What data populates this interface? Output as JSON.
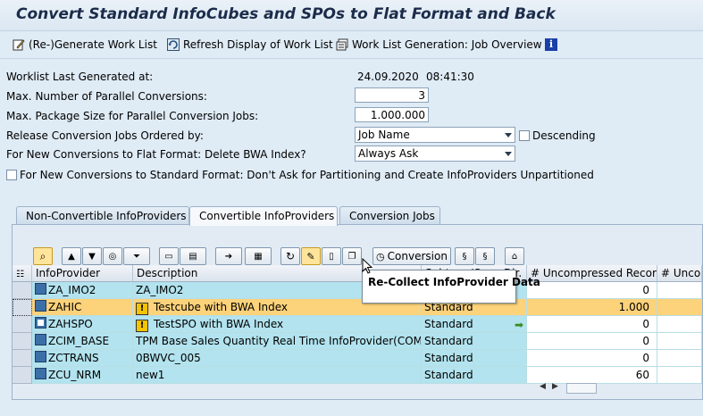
{
  "window": {
    "title": "Convert Standard InfoCubes and SPOs to Flat Format and Back"
  },
  "appbar": {
    "regenerate_label": "(Re-)Generate Work List",
    "refresh_label": "Refresh Display of Work List",
    "job_overview_label": "Work List Generation: Job Overview",
    "info_icon": "i"
  },
  "form": {
    "worklist_generated_label": "Worklist Last Generated at:",
    "worklist_date": "24.09.2020",
    "worklist_time": "08:41:30",
    "max_parallel_label": "Max. Number of Parallel Conversions:",
    "max_parallel_value": "3",
    "max_package_label": "Max. Package Size for Parallel Conversion Jobs:",
    "max_package_value": "1.000.000",
    "release_order_label": "Release Conversion Jobs Ordered by:",
    "release_order_value": "Job Name",
    "descending_label": "Descending",
    "delete_bwa_label": "For New Conversions to Flat Format: Delete BWA Index?",
    "delete_bwa_value": "Always Ask",
    "partition_label": "For New Conversions to Standard Format: Don't Ask for Partitioning and Create InfoProviders Unpartitioned"
  },
  "tabs": [
    {
      "label": "Non-Convertible InfoProviders"
    },
    {
      "label": "Convertible InfoProviders"
    },
    {
      "label": "Conversion Jobs"
    }
  ],
  "toolbar": {
    "conversion_label": "Conversion"
  },
  "tooltip": "Re-Collect InfoProvider Data",
  "grid": {
    "headers": [
      "InfoProvider",
      "Description",
      "Subtype/Copy Dir.",
      "# Uncompressed Records",
      "# Uncom"
    ],
    "rows": [
      {
        "provider": "ZA_IMO2",
        "description": "ZA_IMO2",
        "warn": false,
        "subtype": "",
        "records": "0",
        "icon": "cube"
      },
      {
        "provider": "ZAHIC",
        "description": "Testcube with BWA Index",
        "warn": true,
        "subtype": "Standard",
        "records": "1.000",
        "icon": "cube"
      },
      {
        "provider": "ZAHSPO",
        "description": "TestSPO with BWA Index",
        "warn": true,
        "subtype": "Standard",
        "records": "0",
        "icon": "spo"
      },
      {
        "provider": "ZCIM_BASE",
        "description": "TPM Base Sales Quantity Real Time InfoProvider(COMP)",
        "warn": false,
        "subtype": "Standard",
        "records": "0",
        "icon": "cube"
      },
      {
        "provider": "ZCTRANS",
        "description": "0BWVC_005",
        "warn": false,
        "subtype": "Standard",
        "records": "0",
        "icon": "cube"
      },
      {
        "provider": "ZCU_NRM",
        "description": "new1",
        "warn": false,
        "subtype": "Standard",
        "records": "60",
        "icon": "cube"
      }
    ]
  }
}
